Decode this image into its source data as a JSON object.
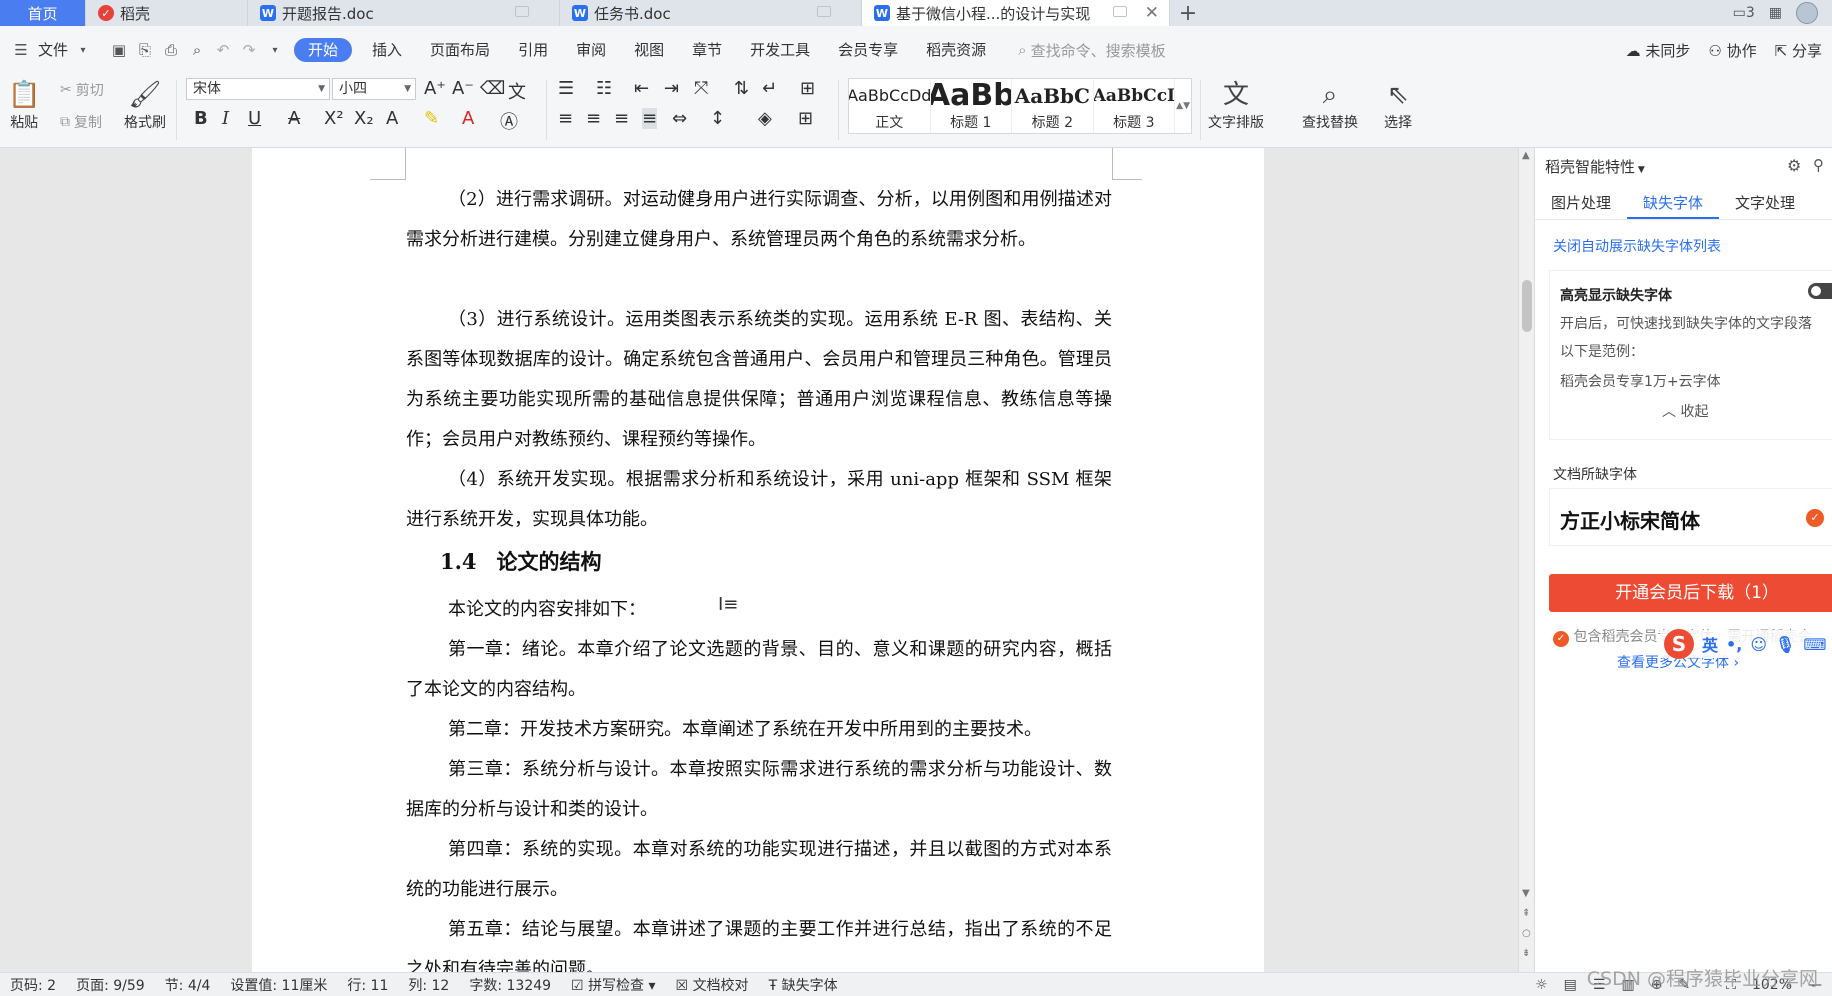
{
  "titlebar": {
    "home_tab": "首页",
    "tabs": [
      {
        "label": "稻壳"
      },
      {
        "label": "开题报告.doc"
      },
      {
        "label": "任务书.doc"
      },
      {
        "label": "基于微信小程...的设计与实现"
      }
    ],
    "new_tab": "+",
    "page_count_badge": "3"
  },
  "menubar": {
    "file": "文件",
    "items": [
      "开始",
      "插入",
      "页面布局",
      "引用",
      "审阅",
      "视图",
      "章节",
      "开发工具",
      "会员专享",
      "稻壳资源"
    ],
    "active": "开始",
    "search_placeholder": "查找命令、搜索模板",
    "sync": "未同步",
    "collab": "协作",
    "share": "分享"
  },
  "ribbon": {
    "paste": "粘贴",
    "cut": "剪切",
    "copy": "复制",
    "format_painter": "格式刷",
    "font_family": "宋体",
    "font_size": "小四",
    "styles": [
      {
        "preview": "AaBbCcDd",
        "caption": "正文"
      },
      {
        "preview": "AaBb",
        "caption": "标题 1"
      },
      {
        "preview": "AaBbC",
        "caption": "标题 2"
      },
      {
        "preview": "AaBbCcI",
        "caption": "标题 3"
      }
    ],
    "text_layout": "文字排版",
    "find_replace": "查找替换",
    "select": "选择"
  },
  "document": {
    "paragraphs": [
      "（2）进行需求调研。对运动健身用户进行实际调查、分析，以用例图和用例描述对需求分析进行建模。分别建立健身用户、系统管理员两个角色的系统需求分析。",
      "（3）进行系统设计。运用类图表示系统类的实现。运用系统 E-R 图、表结构、关系图等体现数据库的设计。确定系统包含普通用户、会员用户和管理员三种角色。管理员为系统主要功能实现所需的基础信息提供保障；普通用户浏览课程信息、教练信息等操作；会员用户对教练预约、课程预约等操作。",
      "（4）系统开发实现。根据需求分析和系统设计，采用 uni-app 框架和 SSM 框架进行系统开发，实现具体功能。"
    ],
    "heading_number": "1.4",
    "heading_text": "论文的结构",
    "paragraphs2": [
      "本论文的内容安排如下：",
      "第一章：绪论。本章介绍了论文选题的背景、目的、意义和课题的研究内容，概括了本论文的内容结构。",
      "第二章：开发技术方案研究。本章阐述了系统在开发中所用到的主要技术。",
      "第三章：系统分析与设计。本章按照实际需求进行系统的需求分析与功能设计、数据库的分析与设计和类的设计。",
      "第四章：系统的实现。本章对系统的功能实现进行描述，并且以截图的方式对本系统的功能进行展示。",
      "第五章：结论与展望。本章讲述了课题的主要工作并进行总结，指出了系统的不足之处和有待完善的问题。"
    ]
  },
  "sidepanel": {
    "title": "稻壳智能特性",
    "tabs": [
      "图片处理",
      "缺失字体",
      "文字处理"
    ],
    "active_tab": "缺失字体",
    "close_auto_link": "关闭自动展示缺失字体列表",
    "highlight_title": "高亮显示缺失字体",
    "highlight_desc": "开启后，可快速找到缺失字体的文字段落",
    "example_label": "以下是范例：",
    "example_text": "稻壳会员专享1万+云字体",
    "collapse": "收起",
    "missing_fonts_label": "文档所缺字体",
    "missing_font_name": "方正小标宋简体",
    "download_button": "开通会员后下载（1）",
    "member_note": "包含稻壳会员专享字体，需开通稻壳会",
    "more_fonts_link": "查看更多公文字体 ›"
  },
  "ime": {
    "lang": "英"
  },
  "statusbar": {
    "page_code": "页码: 2",
    "page": "页面: 9/59",
    "section": "节: 4/4",
    "setting": "设置值: 11厘米",
    "line": "行: 11",
    "col": "列: 12",
    "wordcount": "字数: 13249",
    "spellcheck": "拼写检查",
    "doc_proof": "文档校对",
    "missing_font": "缺失字体",
    "zoom": "102%"
  },
  "watermark": "CSDN @程序猿毕业分享网",
  "colors": {
    "accent": "#4a7df0",
    "download_red": "#ee4b34",
    "link_blue": "#2b6ff1"
  }
}
